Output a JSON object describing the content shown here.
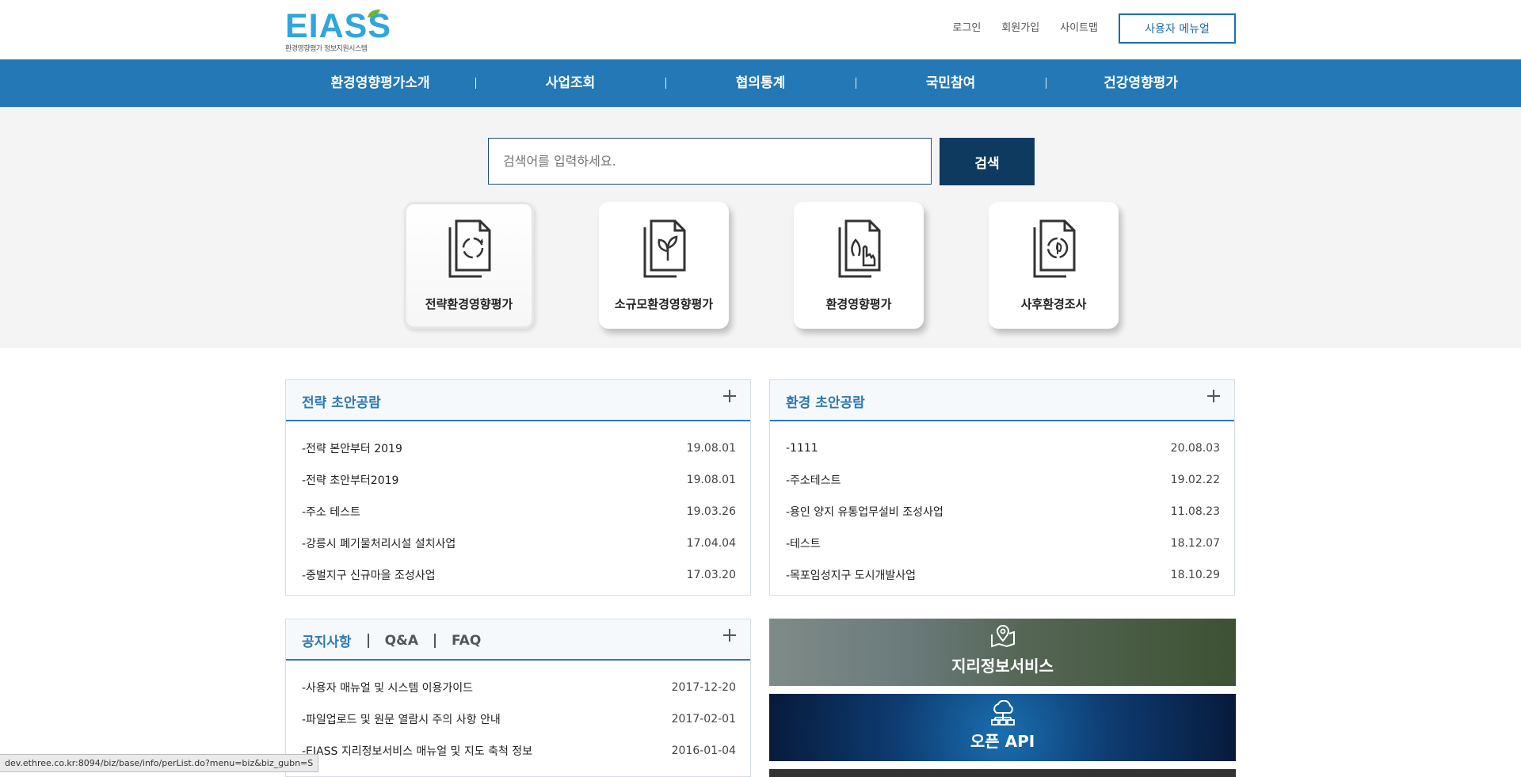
{
  "header": {
    "logo_text": "EIASS",
    "logo_sub": "환경영향평가 정보지원시스템",
    "links": [
      "로그인",
      "회원가입",
      "사이트맵"
    ],
    "manual_label": "사용자 메뉴얼"
  },
  "gnb": [
    "환경영향평가소개",
    "사업조회",
    "협의통계",
    "국민참여",
    "건강영향평가"
  ],
  "search": {
    "placeholder": "검색어를 입력하세요.",
    "button": "검색"
  },
  "cards": [
    {
      "label": "전략환경영향평가",
      "icon": "document-cycle-icon"
    },
    {
      "label": "소규모환경영향평가",
      "icon": "document-leaf-icon"
    },
    {
      "label": "환경영향평가",
      "icon": "document-hand-icon"
    },
    {
      "label": "사후환경조사",
      "icon": "document-refresh-leaf-icon"
    }
  ],
  "board_strategy": {
    "title": "전략 초안공람",
    "rows": [
      {
        "title": "-전략 본안부터 2019",
        "date": "19.08.01"
      },
      {
        "title": "-전략 초안부터2019",
        "date": "19.08.01"
      },
      {
        "title": "-주소 테스트",
        "date": "19.03.26"
      },
      {
        "title": "-강릉시 폐기물처리시설 설치사업",
        "date": "17.04.04"
      },
      {
        "title": "-중벌지구 신규마을 조성사업",
        "date": "17.03.20"
      }
    ]
  },
  "board_env": {
    "title": "환경 초안공람",
    "rows": [
      {
        "title": "-1111",
        "date": "20.08.03"
      },
      {
        "title": "-주소테스트",
        "date": "19.02.22"
      },
      {
        "title": "-용인 양지 유통업무설비 조성사업",
        "date": "11.08.23"
      },
      {
        "title": "-테스트",
        "date": "18.12.07"
      },
      {
        "title": "-목포임성지구 도시개발사업",
        "date": "18.10.29"
      }
    ]
  },
  "board_notice": {
    "tabs": [
      "공지사항",
      "Q&A",
      "FAQ"
    ],
    "rows": [
      {
        "title": "-사용자 매뉴얼 및 시스템 이용가이드",
        "date": "2017-12-20"
      },
      {
        "title": "-파일업로드 및 원문 열람시 주의 사항 안내",
        "date": "2017-02-01"
      },
      {
        "title": "-EIASS 지리정보서비스 매뉴얼 및 지도 축척 정보",
        "date": "2016-01-04"
      }
    ]
  },
  "banners": [
    {
      "label": "지리정보서비스",
      "icon": "map-pin-icon"
    },
    {
      "label": "오픈 API",
      "icon": "cloud-network-icon"
    }
  ],
  "status_url": "dev.ethree.co.kr:8094/biz/base/info/perList.do?menu=biz&biz_gubn=S",
  "colors": {
    "primary": "#2378b5",
    "dark": "#0e3a60",
    "accent": "#2e78b3"
  }
}
